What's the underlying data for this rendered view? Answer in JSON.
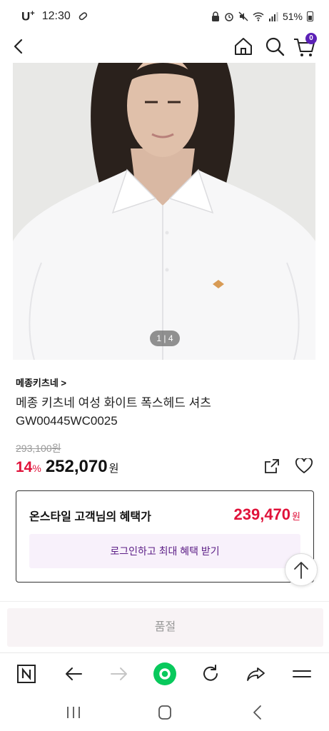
{
  "status_bar": {
    "carrier": "U",
    "carrier_sup": "+",
    "time": "12:30",
    "battery": "51%"
  },
  "header": {
    "cart_count": "0"
  },
  "gallery": {
    "counter": "1 | 4"
  },
  "product": {
    "brand": "메종키츠네 >",
    "name_line1": "메종 키츠네 여성 화이트 폭스헤드 셔츠",
    "name_line2": "GW00445WC0025",
    "original_price": "293,100원",
    "discount": "14",
    "discount_sign": "%",
    "sale_price": "252,070",
    "currency": "원"
  },
  "benefit": {
    "title": "온스타일 고객님의 혜택가",
    "price": "239,470",
    "currency": "원",
    "login_label": "로그인하고 최대 혜택 받기"
  },
  "action": {
    "soldout_label": "품절"
  },
  "colors": {
    "accent_red": "#e0123a",
    "brand_purple": "#5b21b6",
    "browser_green": "#08c95c"
  }
}
